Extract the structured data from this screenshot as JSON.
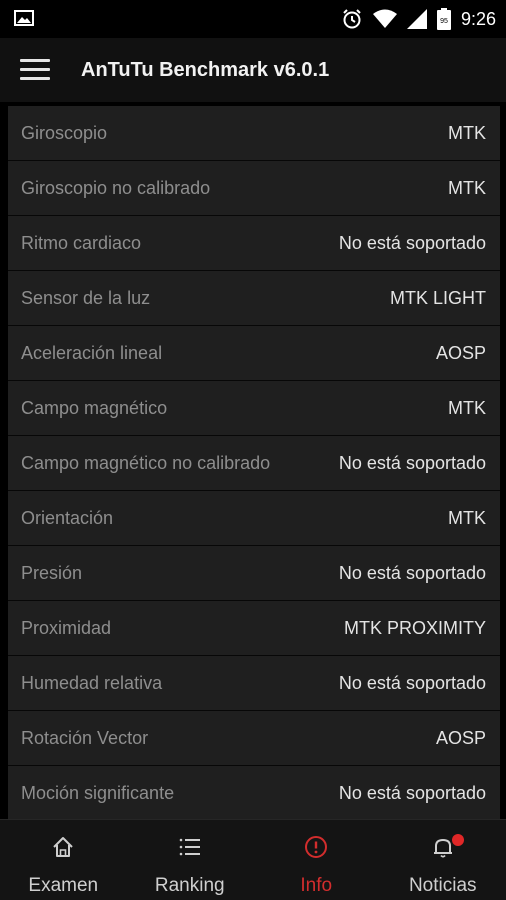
{
  "status_bar": {
    "time": "9:26",
    "battery_level": "95"
  },
  "app_bar": {
    "title": "AnTuTu Benchmark v6.0.1"
  },
  "sensors": [
    {
      "name": "Giroscopio",
      "value": "MTK"
    },
    {
      "name": "Giroscopio no calibrado",
      "value": "MTK"
    },
    {
      "name": "Ritmo cardiaco",
      "value": "No está soportado"
    },
    {
      "name": "Sensor de la luz",
      "value": "MTK LIGHT"
    },
    {
      "name": "Aceleración lineal",
      "value": "AOSP"
    },
    {
      "name": "Campo magnético",
      "value": "MTK"
    },
    {
      "name": "Campo magnético no calibrado",
      "value": "No está soportado"
    },
    {
      "name": "Orientación",
      "value": "MTK"
    },
    {
      "name": "Presión",
      "value": "No está soportado"
    },
    {
      "name": "Proximidad",
      "value": "MTK PROXIMITY"
    },
    {
      "name": "Humedad relativa",
      "value": "No está soportado"
    },
    {
      "name": "Rotación Vector",
      "value": "AOSP"
    },
    {
      "name": "Moción significante",
      "value": "No está soportado"
    }
  ],
  "bottom_nav": [
    {
      "label": "Examen",
      "icon": "home-icon"
    },
    {
      "label": "Ranking",
      "icon": "list-icon"
    },
    {
      "label": "Info",
      "icon": "info-alert-icon",
      "active": true
    },
    {
      "label": "Noticias",
      "icon": "bell-icon",
      "badge": true
    }
  ],
  "colors": {
    "accent": "#d22d2d",
    "row_bg": "#1f1f1f",
    "app_bar": "#111111"
  }
}
